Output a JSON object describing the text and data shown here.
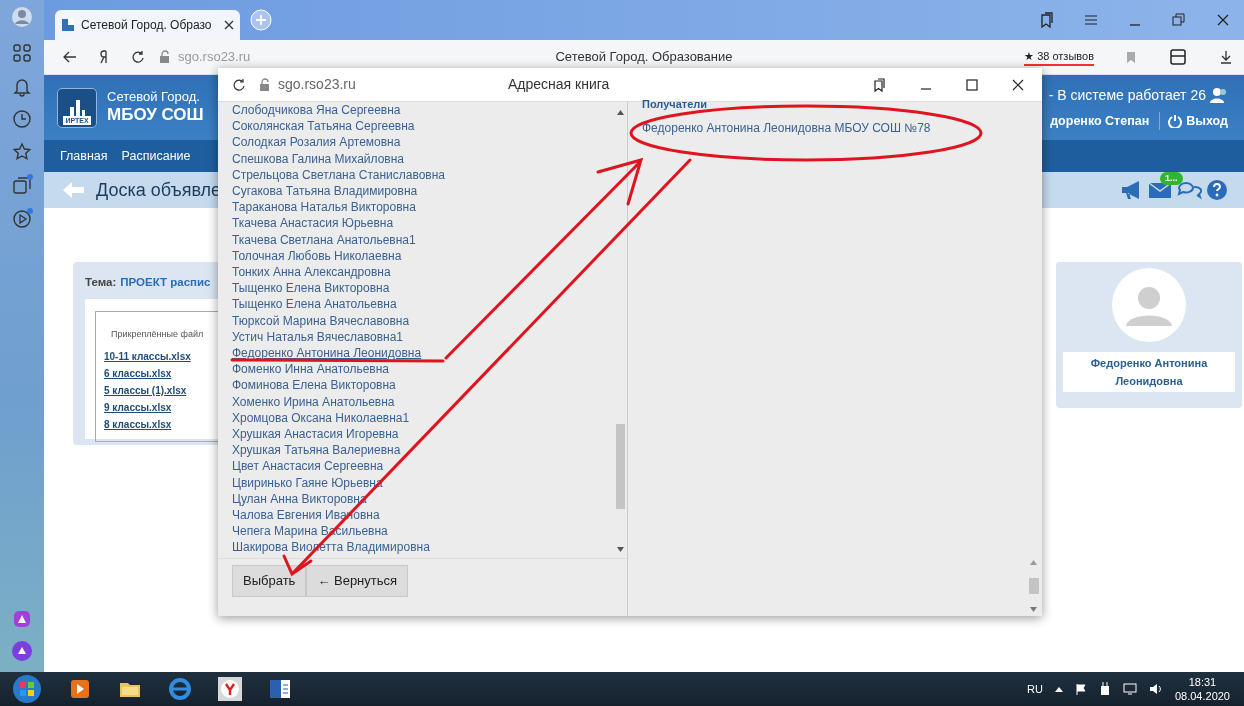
{
  "browser": {
    "tabs": [
      {
        "title": "Сетевой Город. Образо",
        "selected": true
      }
    ],
    "address": "sgo.rso23.ru",
    "page_title": "Сетевой Город. Образование",
    "reviews": "★ 38 отзывов"
  },
  "site": {
    "logo_text": "ИРТЕХ",
    "brand": "Сетевой Город.",
    "school": "МБОУ СОШ",
    "online": "- В системе работает 26",
    "user": "доренко Степан",
    "logout": "Выход",
    "nav": [
      "Главная",
      "Расписание"
    ],
    "breadcrumb": "Доска объявле",
    "mail_badge": "1..."
  },
  "topic": {
    "label": "Тема:",
    "value": "ПРОЕКТ распис",
    "files_legend": "Прикреплённые файл",
    "files": [
      "10-11 классы.xlsx",
      "6 классы.xlsx",
      "5 классы (1).xlsx",
      "9 классы.xlsx",
      "8 классы.xlsx"
    ]
  },
  "profile": {
    "name": "Федоренко Антонина Леонидовна"
  },
  "dialog": {
    "address": "sgo.rso23.ru",
    "title": "Адресная книга",
    "contacts": [
      {
        "name": "Слободчикова Яна Сергеевна",
        "selected": false
      },
      {
        "name": "Соколянская Татьяна Сергеевна",
        "selected": false
      },
      {
        "name": "Солодкая Розалия Артемовна",
        "selected": false
      },
      {
        "name": "Спешкова Галина Михайловна",
        "selected": false
      },
      {
        "name": "Стрельцова Светлана Станиславовна",
        "selected": false
      },
      {
        "name": "Сугакова Татьяна Владимировна",
        "selected": false
      },
      {
        "name": "Тараканова Наталья Викторовна",
        "selected": false
      },
      {
        "name": "Ткачева Анастасия Юрьевна",
        "selected": false
      },
      {
        "name": "Ткачева Светлана Анатольевна1",
        "selected": false
      },
      {
        "name": "Толочная Любовь Николаевна",
        "selected": false
      },
      {
        "name": "Тонких Анна Александровна",
        "selected": false
      },
      {
        "name": "Тыщенко Елена Викторовна",
        "selected": false
      },
      {
        "name": "Тыщенко Елена Анатольевна",
        "selected": false
      },
      {
        "name": "Тюрксой Марина Вячеславовна",
        "selected": false
      },
      {
        "name": "Устич Наталья Вячеславовна1",
        "selected": false
      },
      {
        "name": "Федоренко Антонина Леонидовна",
        "selected": true
      },
      {
        "name": "Фоменко Инна Анатольевна",
        "selected": false
      },
      {
        "name": "Фоминова Елена Викторовна",
        "selected": false
      },
      {
        "name": "Хоменко Ирина Анатольевна",
        "selected": false
      },
      {
        "name": "Хромцова Оксана Николаевна1",
        "selected": false
      },
      {
        "name": "Хрушкая Анастасия Игоревна",
        "selected": false
      },
      {
        "name": "Хрушкая Татьяна Валериевна",
        "selected": false
      },
      {
        "name": "Цвет Анастасия Сергеевна",
        "selected": false
      },
      {
        "name": "Цвиринько Гаяне Юрьевна",
        "selected": false
      },
      {
        "name": "Цулан Анна Викторовна",
        "selected": false
      },
      {
        "name": "Чалова Евгения Ивановна",
        "selected": false
      },
      {
        "name": "Чепега Марина Васильевна",
        "selected": false
      },
      {
        "name": "Шакирова Виолетта Владимировна",
        "selected": false
      }
    ],
    "recipients_header": "Получатели",
    "recipients": [
      "Федоренко Антонина Леонидовна МБОУ СОШ №78"
    ],
    "buttons": [
      "Выбрать",
      "← Вернуться"
    ]
  },
  "taskbar": {
    "lang": "RU",
    "time": "18:31",
    "date": "08.04.2020"
  }
}
